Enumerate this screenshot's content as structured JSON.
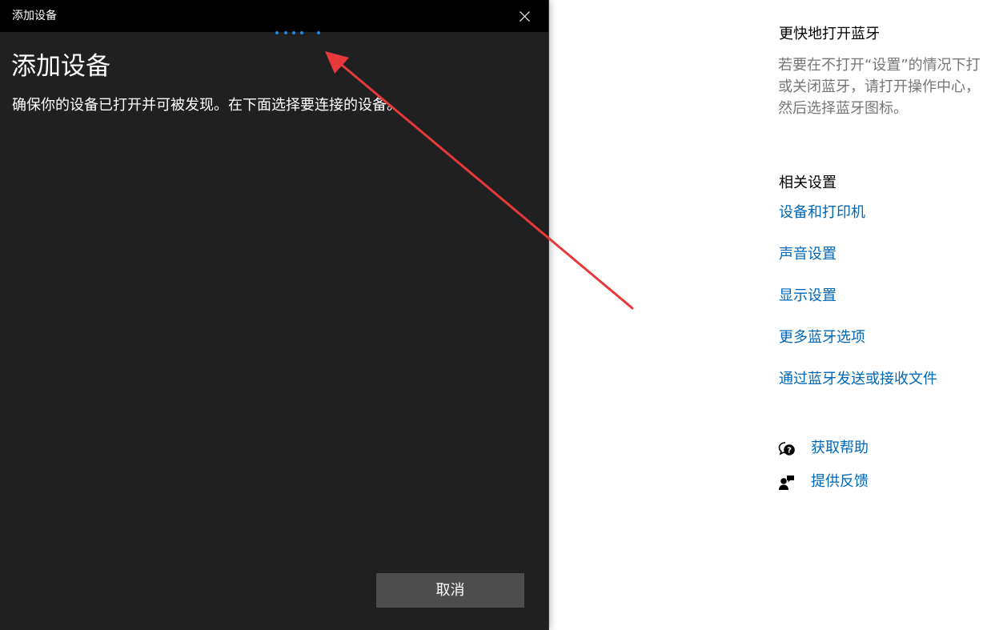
{
  "dialog": {
    "window_title": "添加设备",
    "heading": "添加设备",
    "description": "确保你的设备已打开并可被发现。在下面选择要连接的设备。",
    "cancel_label": "取消",
    "close_icon": "close-icon",
    "progress_indicator": "loading-dots"
  },
  "settings": {
    "quick_open": {
      "title": "更快地打开蓝牙",
      "lines": [
        "若要在不打开“设置”的情况下打",
        "或关闭蓝牙，请打开操作中心，",
        "然后选择蓝牙图标。"
      ]
    },
    "related": {
      "title": "相关设置",
      "links": [
        "设备和打印机",
        "声音设置",
        "显示设置",
        "更多蓝牙选项",
        "通过蓝牙发送或接收文件"
      ]
    },
    "help": {
      "get_help": "获取帮助",
      "get_help_icon": "help-chat-icon",
      "feedback": "提供反馈",
      "feedback_icon": "feedback-person-icon"
    }
  },
  "colors": {
    "dialog_background": "#202020",
    "titlebar_background": "#000000",
    "cancel_button": "#4d4d4d",
    "link": "#0067b8",
    "accent_dots": "#1a8ae6",
    "annotation_arrow": "#e8393a"
  }
}
